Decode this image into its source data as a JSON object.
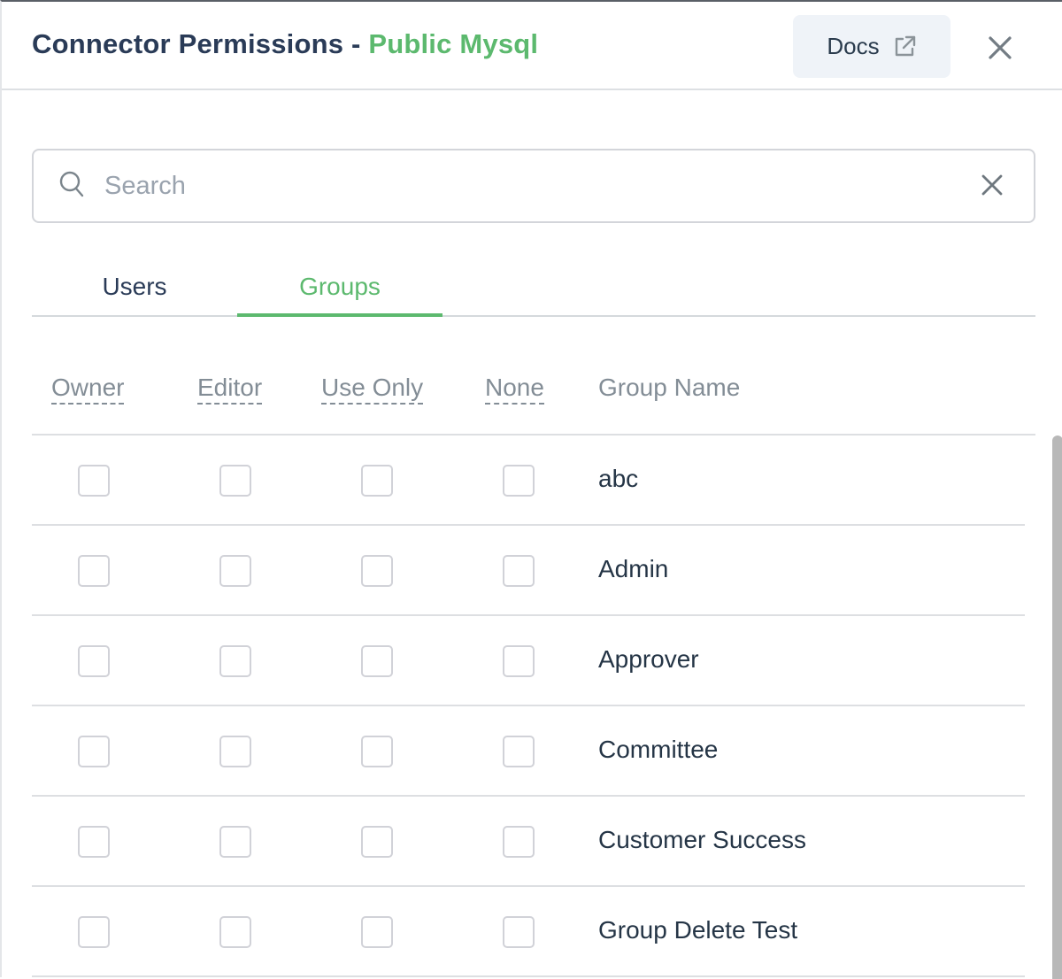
{
  "header": {
    "title_prefix": "Connector Permissions - ",
    "title_name": "Public Mysql",
    "docs_label": "Docs",
    "docs_icon": "external-link-icon",
    "close_icon": "close-icon"
  },
  "search": {
    "placeholder": "Search",
    "value": "",
    "icon": "search-icon",
    "clear_icon": "close-icon"
  },
  "tabs": [
    {
      "label": "Users",
      "active": false
    },
    {
      "label": "Groups",
      "active": true
    }
  ],
  "table": {
    "columns": [
      "Owner",
      "Editor",
      "Use Only",
      "None",
      "Group Name"
    ],
    "rows": [
      {
        "name": "abc",
        "owner": false,
        "editor": false,
        "use_only": false,
        "none": false
      },
      {
        "name": "Admin",
        "owner": false,
        "editor": false,
        "use_only": false,
        "none": false
      },
      {
        "name": "Approver",
        "owner": false,
        "editor": false,
        "use_only": false,
        "none": false
      },
      {
        "name": "Committee",
        "owner": false,
        "editor": false,
        "use_only": false,
        "none": false
      },
      {
        "name": "Customer Success",
        "owner": false,
        "editor": false,
        "use_only": false,
        "none": false
      },
      {
        "name": "Group Delete Test",
        "owner": false,
        "editor": false,
        "use_only": false,
        "none": false
      }
    ]
  },
  "colors": {
    "accent": "#5cb96e",
    "title": "#2a3b57",
    "text": "#253546",
    "muted": "#838d96"
  }
}
